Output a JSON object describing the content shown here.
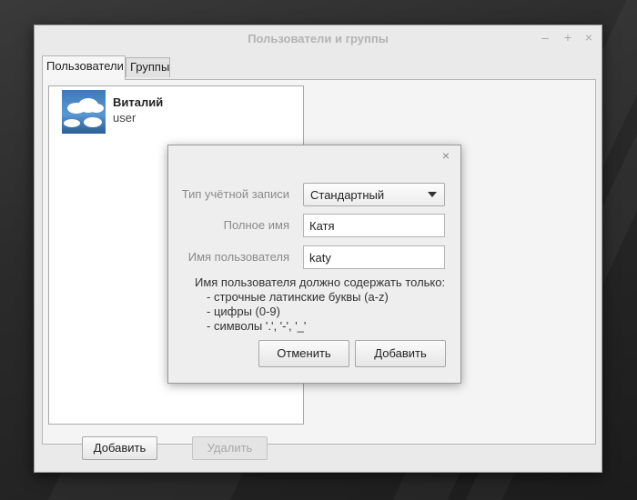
{
  "window": {
    "title": "Пользователи и группы",
    "controls": {
      "minimize": "–",
      "maximize": "+",
      "close": "×"
    }
  },
  "tabs": [
    {
      "label": "Пользователи",
      "active": true
    },
    {
      "label": "Группы",
      "active": false
    }
  ],
  "users": [
    {
      "name": "Виталий",
      "login": "user",
      "avatar_icon": "sky-clouds-avatar"
    }
  ],
  "buttons": {
    "add": "Добавить",
    "delete": "Удалить"
  },
  "dialog": {
    "close": "×",
    "account_type_label": "Тип учётной записи",
    "account_type_value": "Стандартный",
    "full_name_label": "Полное имя",
    "full_name_value": "Катя",
    "username_label": "Имя пользователя",
    "username_value": "katy",
    "hint_lines": [
      "Имя пользователя должно содержать только:",
      "- строчные латинские буквы (a-z)",
      "- цифры (0-9)",
      "- символы '.', '-', '_'"
    ],
    "cancel_label": "Отменить",
    "add_label": "Добавить"
  },
  "colors": {
    "window_bg": "#eaeaea",
    "dialog_bg": "#eeeeee",
    "disabled_text": "#a8a8a8"
  }
}
